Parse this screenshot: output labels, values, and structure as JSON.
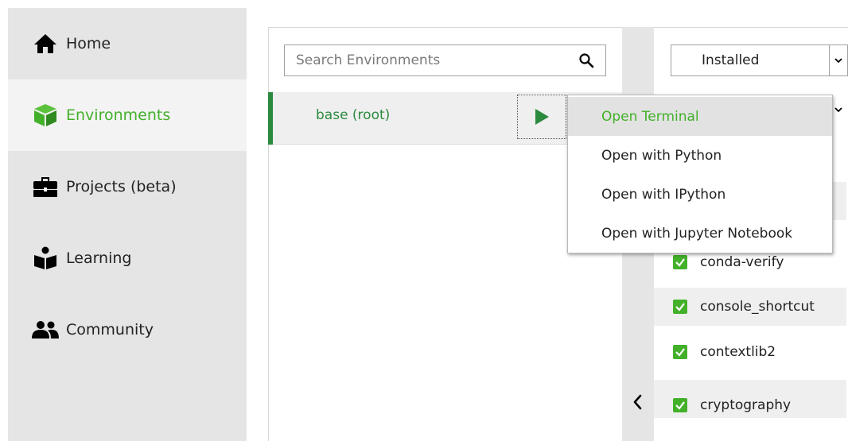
{
  "colors": {
    "accent": "#43b02a",
    "env_text": "#2b8a3e"
  },
  "sidebar": {
    "items": [
      {
        "label": "Home",
        "icon": "home-icon"
      },
      {
        "label": "Environments",
        "icon": "cube-icon",
        "active": true
      },
      {
        "label": "Projects (beta)",
        "icon": "briefcase-icon"
      },
      {
        "label": "Learning",
        "icon": "learning-icon"
      },
      {
        "label": "Community",
        "icon": "people-icon"
      }
    ]
  },
  "environments": {
    "search": {
      "placeholder": "Search Environments",
      "icon": "search-icon"
    },
    "list": [
      {
        "name": "base (root)",
        "selected": true
      }
    ]
  },
  "packages": {
    "filter": {
      "value": "Installed"
    },
    "items": [
      {
        "name": "conda-verify",
        "checked": true
      },
      {
        "name": "console_shortcut",
        "checked": true
      },
      {
        "name": "contextlib2",
        "checked": true
      },
      {
        "name": "cryptography",
        "checked": true
      }
    ]
  },
  "context_menu": {
    "items": [
      {
        "label": "Open Terminal",
        "hovered": true
      },
      {
        "label": "Open with Python"
      },
      {
        "label": "Open with IPython"
      },
      {
        "label": "Open with Jupyter Notebook"
      }
    ]
  }
}
